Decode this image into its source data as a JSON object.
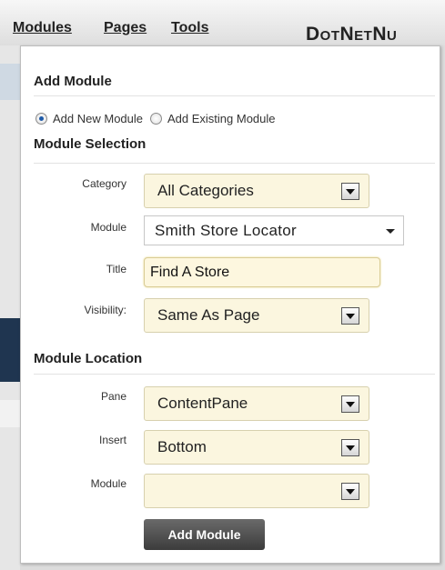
{
  "menu": {
    "items": [
      "Modules",
      "Pages",
      "Tools"
    ],
    "logo_text": "DotNetNu"
  },
  "panel": {
    "add_module_title": "Add Module",
    "radios": [
      {
        "label": "Add New Module",
        "checked": true
      },
      {
        "label": "Add Existing Module",
        "checked": false
      }
    ],
    "module_selection_title": "Module Selection",
    "category": {
      "label": "Category",
      "value": "All Categories"
    },
    "module": {
      "label": "Module",
      "value": "Smith Store Locator"
    },
    "title_field": {
      "label": "Title",
      "value": "Find A Store"
    },
    "visibility": {
      "label": "Visibility:",
      "value": "Same As Page"
    },
    "module_location_title": "Module Location",
    "pane": {
      "label": "Pane",
      "value": "ContentPane"
    },
    "insert": {
      "label": "Insert",
      "value": "Bottom"
    },
    "location_module": {
      "label": "Module",
      "value": ""
    },
    "add_button_label": "Add Module"
  },
  "colors": {
    "select_bg": "#fbf6df",
    "button_bg": "#4a4a4a"
  }
}
